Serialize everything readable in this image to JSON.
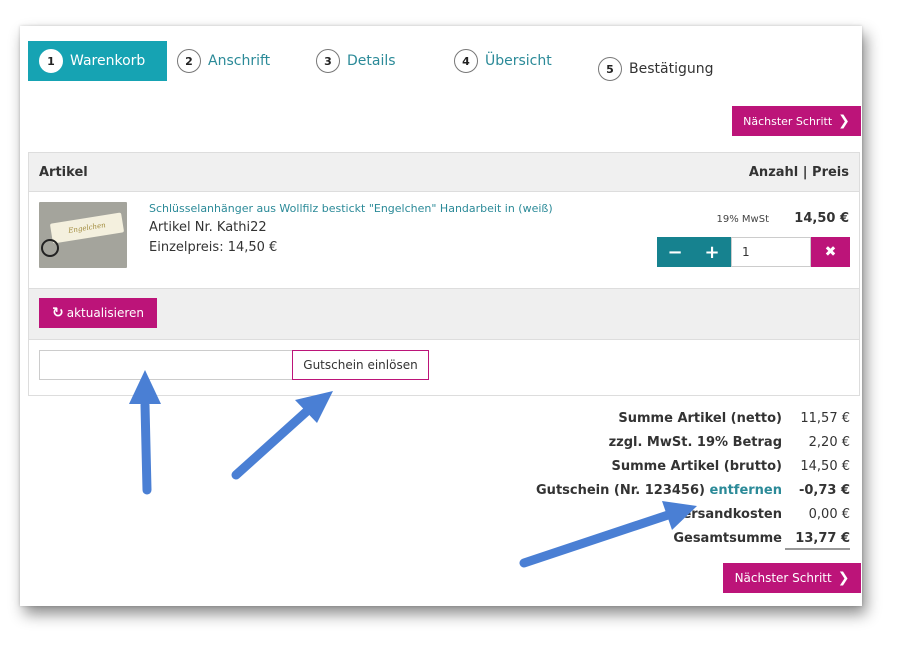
{
  "steps": [
    {
      "num": "1",
      "label": "Warenkorb"
    },
    {
      "num": "2",
      "label": "Anschrift"
    },
    {
      "num": "3",
      "label": "Details"
    },
    {
      "num": "4",
      "label": "Übersicht"
    },
    {
      "num": "5",
      "label": "Bestätigung"
    }
  ],
  "next_step_label": "Nächster Schritt",
  "table": {
    "col_article": "Artikel",
    "col_qty_price": "Anzahl | Preis"
  },
  "item": {
    "title": "Schlüsselanhänger aus Wollfilz bestickt \"Engelchen\" Handarbeit in (weiß)",
    "article_no": "Artikel Nr. Kathi22",
    "unit_price": "Einzelpreis: 14,50 €",
    "tax": "19% MwSt",
    "price": "14,50 €",
    "quantity": "1",
    "image_text": "Engelchen"
  },
  "update_label": "aktualisieren",
  "coupon": {
    "placeholder": "",
    "button_label": "Gutschein einlösen"
  },
  "summary": {
    "net_label": "Summe Artikel (netto)",
    "net_value": "11,57 €",
    "vat_label": "zzgl. MwSt. 19% Betrag",
    "vat_value": "2,20 €",
    "gross_label": "Summe Artikel (brutto)",
    "gross_value": "14,50 €",
    "coupon_label": "Gutschein (Nr. 123456)",
    "coupon_remove": "entfernen",
    "coupon_value": "-0,73 €",
    "shipping_label": "Versandkosten",
    "shipping_value": "0,00 €",
    "total_label": "Gesamtsumme",
    "total_value": "13,77 €"
  },
  "colors": {
    "teal": "#16a3b3",
    "magenta": "#bc1479",
    "arrow": "#4a7fd4"
  }
}
